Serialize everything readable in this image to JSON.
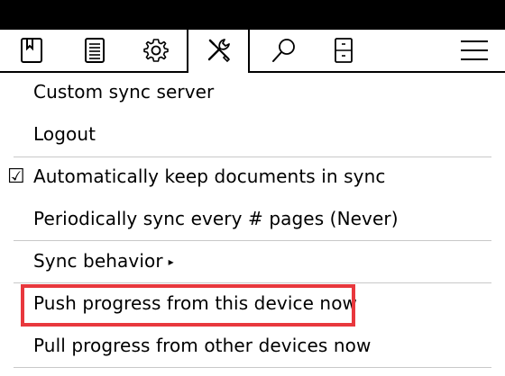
{
  "tabs": [
    {
      "name": "bookmark",
      "icon": "bookmark-icon"
    },
    {
      "name": "document",
      "icon": "document-lines-icon"
    },
    {
      "name": "settings",
      "icon": "gear-icon"
    },
    {
      "name": "tools",
      "icon": "tools-icon",
      "active": true
    },
    {
      "name": "search",
      "icon": "search-icon"
    },
    {
      "name": "filing",
      "icon": "filing-cabinet-icon"
    },
    {
      "name": "menu",
      "icon": "hamburger-menu-icon"
    }
  ],
  "menu": {
    "items": [
      {
        "label": "Custom sync server"
      },
      {
        "label": "Logout"
      },
      {
        "label": "Automatically keep documents in sync",
        "checked": true,
        "check_glyph": "☑"
      },
      {
        "label": "Periodically sync every # pages (Never)"
      },
      {
        "label": "Sync behavior",
        "submenu_glyph": "▸"
      },
      {
        "label": "Push progress from this device now",
        "highlighted": true
      },
      {
        "label": "Pull progress from other devices now"
      }
    ]
  },
  "colors": {
    "highlight": "#e8383d",
    "topbar": "#000000"
  }
}
